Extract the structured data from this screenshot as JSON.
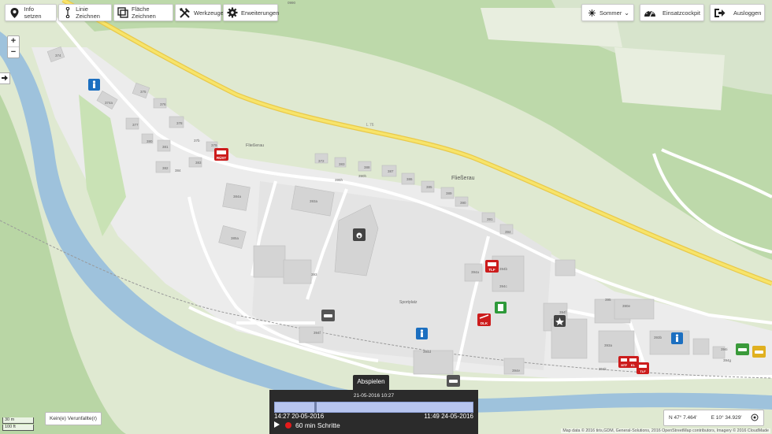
{
  "toolbar": {
    "info": "Info setzen",
    "line": "Linie Zeichnen",
    "area": "Fläche Zeichnen",
    "tools": "Werkzeuge",
    "extensions": "Erweiterungen",
    "season": "Sommer",
    "cockpit": "Einsatzcockpit",
    "logout": "Ausloggen"
  },
  "zoom": {
    "in": "+",
    "out": "−",
    "expand": "➔"
  },
  "map": {
    "place_label": "Fließerau",
    "place_label_small": "Fließerau",
    "road_label": "L 76",
    "sport_label": "Sportplatz",
    "road_small": "0990",
    "house_numbers": [
      "374",
      "374a",
      "375",
      "376",
      "378",
      "377",
      "380",
      "381",
      "382",
      "383",
      "379",
      "37b",
      "384",
      "372",
      "383",
      "388",
      "387",
      "386",
      "385",
      "389",
      "390",
      "391",
      "394",
      "384a",
      "385a",
      "393a",
      "395h",
      "390h",
      "393",
      "394a",
      "394b",
      "394c",
      "394f",
      "395",
      "390e",
      "393a",
      "394d",
      "394e",
      "394f",
      "394g",
      "394i",
      "394k",
      "393b"
    ],
    "markers": {
      "rust": "RÜST",
      "tlf": "TLF",
      "dlk": "DLK",
      "mtf": "MTF",
      "kl": "KL",
      "tlf2": "TLF"
    }
  },
  "scale": {
    "metric": "30 m",
    "imperial": "100 ft"
  },
  "accidents": "Kein(e) Verunfallte(r)",
  "coords": {
    "lat": "N 47° 7.464'",
    "lng": "E 10° 34.929'"
  },
  "attribution": "Map data © 2016 tiris,GDM, General-Solutions, 2016 OpenStreetMap contributors, Imagery © 2016 CloudMade",
  "player": {
    "tab": "Abspielen",
    "current": "21-05-2016 10:27",
    "start": "14:27 20-05-2016",
    "end": "11:49 24-05-2016",
    "step": "60 min Schritte",
    "progress": 0.2
  }
}
